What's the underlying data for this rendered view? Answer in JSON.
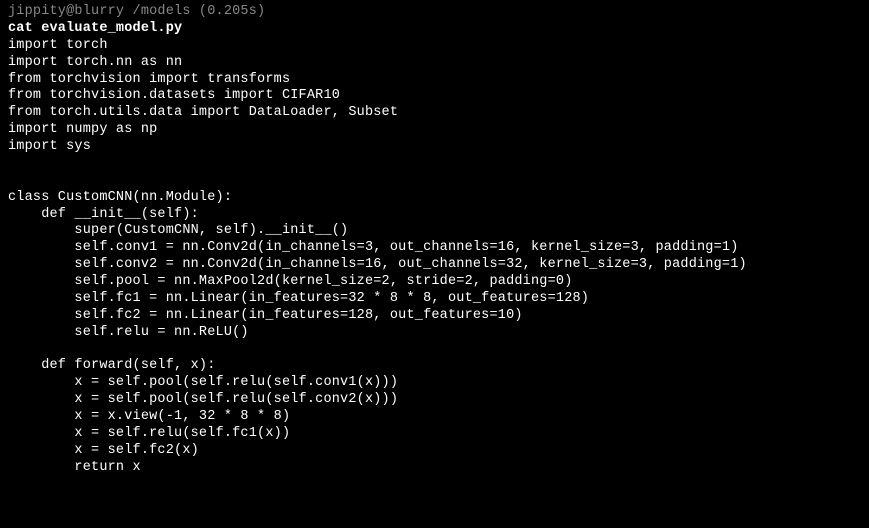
{
  "prompt": "jippity@blurry /models (0.205s)",
  "command": "cat evaluate_model.py",
  "code_lines": [
    "import torch",
    "import torch.nn as nn",
    "from torchvision import transforms",
    "from torchvision.datasets import CIFAR10",
    "from torch.utils.data import DataLoader, Subset",
    "import numpy as np",
    "import sys",
    "",
    "",
    "class CustomCNN(nn.Module):",
    "    def __init__(self):",
    "        super(CustomCNN, self).__init__()",
    "        self.conv1 = nn.Conv2d(in_channels=3, out_channels=16, kernel_size=3, padding=1)",
    "        self.conv2 = nn.Conv2d(in_channels=16, out_channels=32, kernel_size=3, padding=1)",
    "        self.pool = nn.MaxPool2d(kernel_size=2, stride=2, padding=0)",
    "        self.fc1 = nn.Linear(in_features=32 * 8 * 8, out_features=128)",
    "        self.fc2 = nn.Linear(in_features=128, out_features=10)",
    "        self.relu = nn.ReLU()",
    "",
    "    def forward(self, x):",
    "        x = self.pool(self.relu(self.conv1(x)))",
    "        x = self.pool(self.relu(self.conv2(x)))",
    "        x = x.view(-1, 32 * 8 * 8)",
    "        x = self.relu(self.fc1(x))",
    "        x = self.fc2(x)",
    "        return x"
  ]
}
